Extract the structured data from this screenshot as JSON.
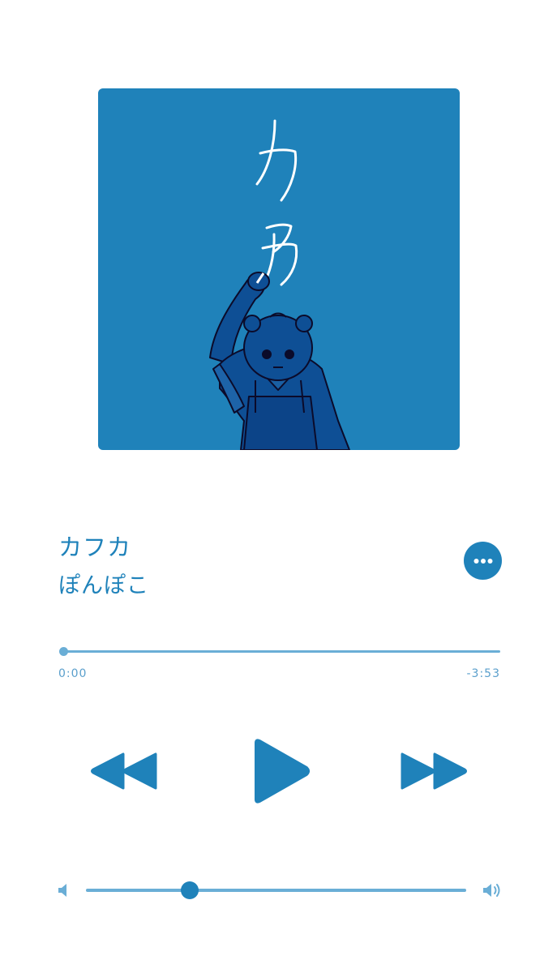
{
  "track": {
    "title": "カフカ",
    "artist": "ぽんぽこ",
    "artwork_text": "カフカ"
  },
  "playback": {
    "elapsed": "0:00",
    "remaining": "-3:53",
    "progress_fraction": 0
  },
  "controls": {
    "more_icon": "ellipsis-icon",
    "rewind_icon": "rewind-icon",
    "play_icon": "play-icon",
    "forward_icon": "fast-forward-icon"
  },
  "volume": {
    "level_fraction": 0.25,
    "low_icon": "speaker-low-icon",
    "high_icon": "speaker-high-icon"
  },
  "colors": {
    "accent": "#1f82ba",
    "accent_light": "#6aaed6",
    "artwork_bg": "#1f82ba",
    "figure": "#0e4f95"
  }
}
